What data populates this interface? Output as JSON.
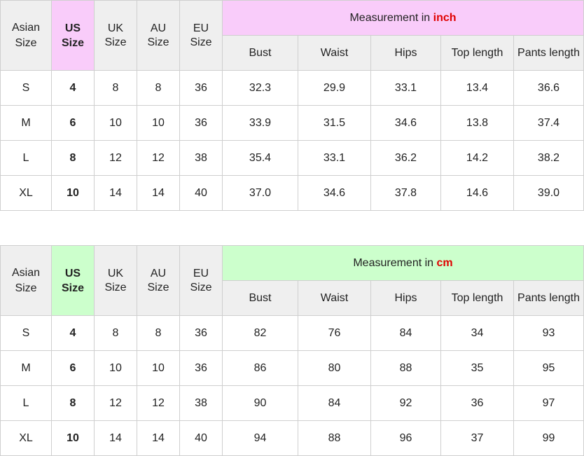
{
  "tables": [
    {
      "headers": {
        "asian": [
          "Asian",
          "Size"
        ],
        "us": [
          "US",
          "Size"
        ],
        "uk": [
          "UK",
          "Size"
        ],
        "au": [
          "AU",
          "Size"
        ],
        "eu": [
          "EU",
          "Size"
        ],
        "measurement_prefix": "Measurement in ",
        "unit": "inch",
        "columns": [
          "Bust",
          "Waist",
          "Hips",
          "Top length",
          "Pants length"
        ]
      },
      "rows": [
        [
          "S",
          "4",
          "8",
          "8",
          "36",
          "32.3",
          "29.9",
          "33.1",
          "13.4",
          "36.6"
        ],
        [
          "M",
          "6",
          "10",
          "10",
          "36",
          "33.9",
          "31.5",
          "34.6",
          "13.8",
          "37.4"
        ],
        [
          "L",
          "8",
          "12",
          "12",
          "38",
          "35.4",
          "33.1",
          "36.2",
          "14.2",
          "38.2"
        ],
        [
          "XL",
          "10",
          "14",
          "14",
          "40",
          "37.0",
          "34.6",
          "37.8",
          "14.6",
          "39.0"
        ]
      ]
    },
    {
      "headers": {
        "asian": [
          "Asian",
          "Size"
        ],
        "us": [
          "US",
          "Size"
        ],
        "uk": [
          "UK",
          "Size"
        ],
        "au": [
          "AU",
          "Size"
        ],
        "eu": [
          "EU",
          "Size"
        ],
        "measurement_prefix": "Measurement in ",
        "unit": "cm",
        "columns": [
          "Bust",
          "Waist",
          "Hips",
          "Top length",
          "Pants length"
        ]
      },
      "rows": [
        [
          "S",
          "4",
          "8",
          "8",
          "36",
          "82",
          "76",
          "84",
          "34",
          "93"
        ],
        [
          "M",
          "6",
          "10",
          "10",
          "36",
          "86",
          "80",
          "88",
          "35",
          "95"
        ],
        [
          "L",
          "8",
          "12",
          "12",
          "38",
          "90",
          "84",
          "92",
          "36",
          "97"
        ],
        [
          "XL",
          "10",
          "14",
          "14",
          "40",
          "94",
          "88",
          "96",
          "37",
          "99"
        ]
      ]
    }
  ],
  "colors": {
    "inch_accent": "#f9ccfa",
    "cm_accent": "#ccffcc",
    "unit_text": "#e00000",
    "header_bg": "#efefef",
    "border": "#cfcfcf"
  }
}
